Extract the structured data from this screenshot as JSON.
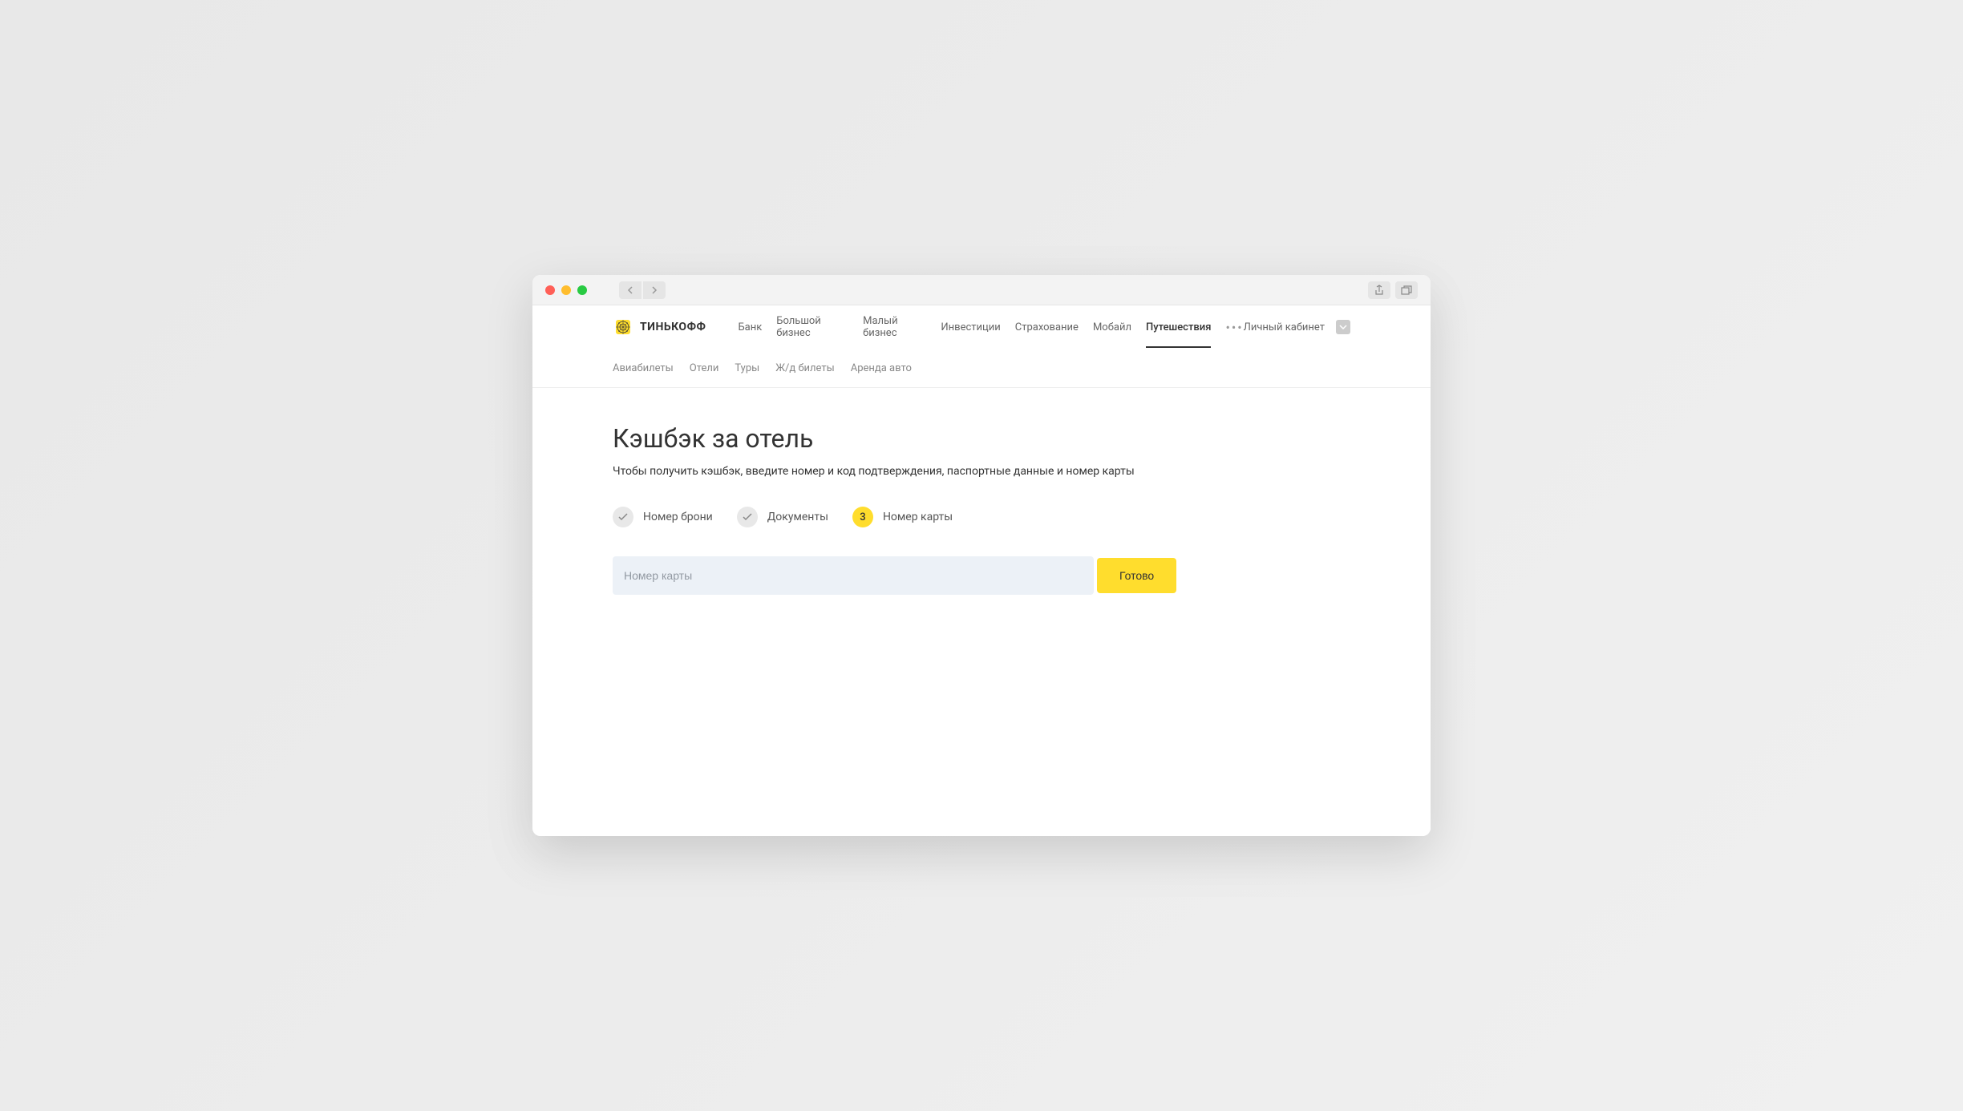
{
  "logo": {
    "text": "ТИНЬКОФФ"
  },
  "main_nav": {
    "items": [
      {
        "label": "Банк",
        "active": false
      },
      {
        "label": "Большой бизнес",
        "active": false
      },
      {
        "label": "Малый бизнес",
        "active": false
      },
      {
        "label": "Инвестиции",
        "active": false
      },
      {
        "label": "Страхование",
        "active": false
      },
      {
        "label": "Мобайл",
        "active": false
      },
      {
        "label": "Путешествия",
        "active": true
      }
    ]
  },
  "account": {
    "label": "Личный кабинет"
  },
  "sub_nav": {
    "items": [
      {
        "label": "Авиабилеты"
      },
      {
        "label": "Отели"
      },
      {
        "label": "Туры"
      },
      {
        "label": "Ж/д билеты"
      },
      {
        "label": "Аренда авто"
      }
    ]
  },
  "page": {
    "title": "Кэшбэк за отель",
    "subtitle": "Чтобы получить кэшбэк, введите номер и код подтверждения, паспортные данные и номер карты"
  },
  "stepper": {
    "steps": [
      {
        "label": "Номер брони",
        "state": "done"
      },
      {
        "label": "Документы",
        "state": "done"
      },
      {
        "number": "3",
        "label": "Номер карты",
        "state": "active"
      }
    ]
  },
  "form": {
    "card_placeholder": "Номер карты",
    "submit_label": "Готово"
  }
}
